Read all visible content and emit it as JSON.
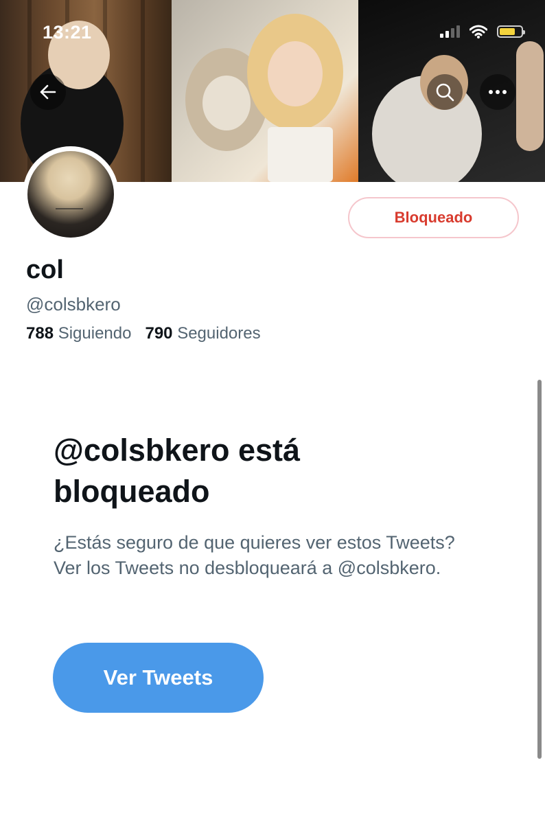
{
  "status_bar": {
    "time": "13:21",
    "signal_icon": "cellular-signal-icon",
    "wifi_icon": "wifi-icon",
    "battery_icon": "battery-icon",
    "battery_color": "#f4d33c"
  },
  "header": {
    "back_icon": "arrow-left-icon",
    "search_icon": "search-icon",
    "more_icon": "more-horizontal-icon"
  },
  "profile": {
    "display_name": "col",
    "handle": "@colsbkero",
    "following_count": "788",
    "following_label": "Siguiendo",
    "followers_count": "790",
    "followers_label": "Seguidores",
    "blocked_button_label": "Bloqueado"
  },
  "blocked_notice": {
    "title": "@colsbkero está bloqueado",
    "body": "¿Estás seguro de que quieres ver estos Tweets? Ver los Tweets no desbloqueará a @colsbkero.",
    "view_button_label": "Ver Tweets"
  },
  "colors": {
    "accent": "#4a99e9",
    "blocked_text": "#d83b2e",
    "blocked_border": "#f5c6cc",
    "secondary_text": "#536471",
    "primary_text": "#0f1419"
  }
}
